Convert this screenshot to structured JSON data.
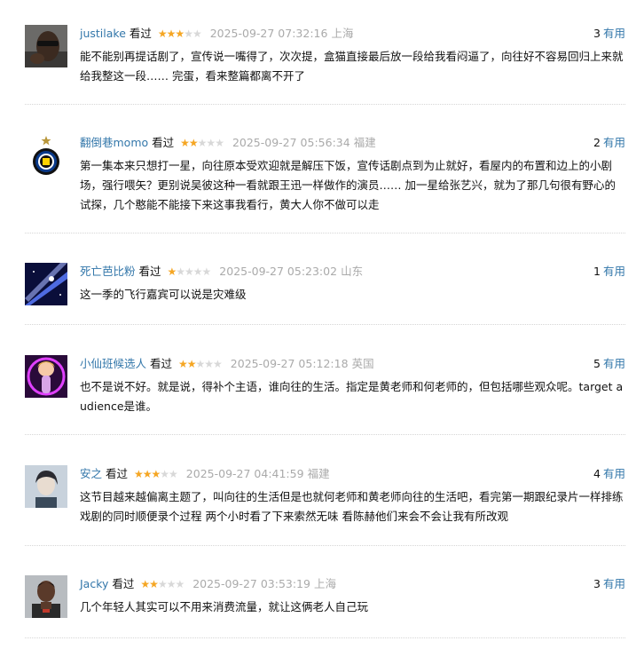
{
  "verb": "看过",
  "useful_label": "有用",
  "comments": [
    {
      "user": "justilake",
      "rating": 3,
      "time": "2025-09-27 07:32:16",
      "region": "上海",
      "votes": "3",
      "text": "能不能别再提话剧了，宣传说一嘴得了，次次提，盒猫直接最后放一段给我看闷逼了，向往好不容易回归上来就给我整这一段…… 完蛋，看来整篇都离不开了",
      "avatar_icon": "man-sunglasses-avatar"
    },
    {
      "user": "翻倒巷momo",
      "rating": 2,
      "time": "2025-09-27 05:56:34",
      "region": "福建",
      "votes": "2",
      "text": "第一集本来只想打一星，向往原本受欢迎就是解压下饭，宣传话剧点到为止就好，看屋内的布置和边上的小剧场，强行喂矢？更别说吴彼这种一看就跟王迅一样做作的演员…… 加一星给张艺兴，就为了那几句很有野心的试探，几个憨能不能接下来这事我看行，黄大人你不做可以走",
      "avatar_icon": "inter-badge-avatar"
    },
    {
      "user": "死亡芭比粉",
      "rating": 1,
      "time": "2025-09-27 05:23:02",
      "region": "山东",
      "votes": "1",
      "text": "这一季的飞行嘉宾可以说是灾难级",
      "avatar_icon": "space-beam-avatar"
    },
    {
      "user": "小仙班候选人",
      "rating": 2,
      "time": "2025-09-27 05:12:18",
      "region": "英国",
      "votes": "5",
      "text": "也不是说不好。就是说，得补个主语，谁向往的生活。指定是黄老师和何老师的，但包括哪些观众呢。target audience是谁。",
      "avatar_icon": "anime-girl-avatar"
    },
    {
      "user": "安之",
      "rating": 3,
      "time": "2025-09-27 04:41:59",
      "region": "福建",
      "votes": "4",
      "text": "这节目越来越偏离主题了，叫向往的生活但是也就何老师和黄老师向往的生活吧，看完第一期跟纪录片一样排练戏剧的同时顺便录个过程 两个小时看了下来索然无味 看陈赫他们来会不会让我有所改观",
      "avatar_icon": "portrait-avatar"
    },
    {
      "user": "Jacky",
      "rating": 2,
      "time": "2025-09-27 03:53:19",
      "region": "上海",
      "votes": "3",
      "text": "几个年轻人其实可以不用来消费流量，就让这俩老人自己玩",
      "avatar_icon": "athlete-avatar"
    }
  ]
}
